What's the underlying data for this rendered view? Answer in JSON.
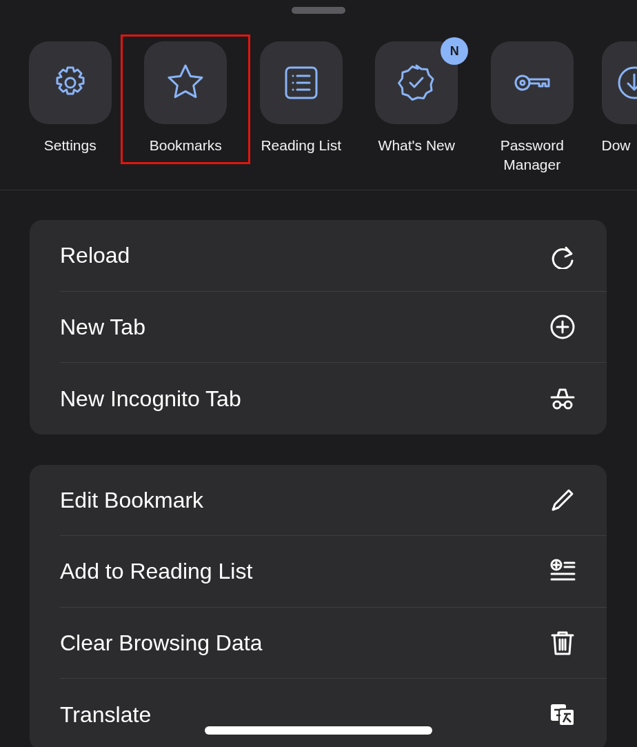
{
  "shortcuts": [
    {
      "kind": "gear",
      "label": "Settings",
      "highlighted": false
    },
    {
      "kind": "star",
      "label": "Bookmarks",
      "highlighted": true
    },
    {
      "kind": "list",
      "label": "Reading List",
      "highlighted": false
    },
    {
      "kind": "badge-check",
      "label": "What's New",
      "highlighted": false,
      "badge": "N"
    },
    {
      "kind": "key",
      "label": "Password Manager",
      "highlighted": false
    },
    {
      "kind": "download",
      "label": "Dow",
      "highlighted": false,
      "cut_off": true
    }
  ],
  "groups": [
    [
      {
        "label": "Reload",
        "kind": "reload"
      },
      {
        "label": "New Tab",
        "kind": "plus-circle"
      },
      {
        "label": "New Incognito Tab",
        "kind": "incognito"
      }
    ],
    [
      {
        "label": "Edit Bookmark",
        "kind": "pencil"
      },
      {
        "label": "Add to Reading List",
        "kind": "add-list"
      },
      {
        "label": "Clear Browsing Data",
        "kind": "trash"
      },
      {
        "label": "Translate",
        "kind": "translate"
      }
    ]
  ]
}
